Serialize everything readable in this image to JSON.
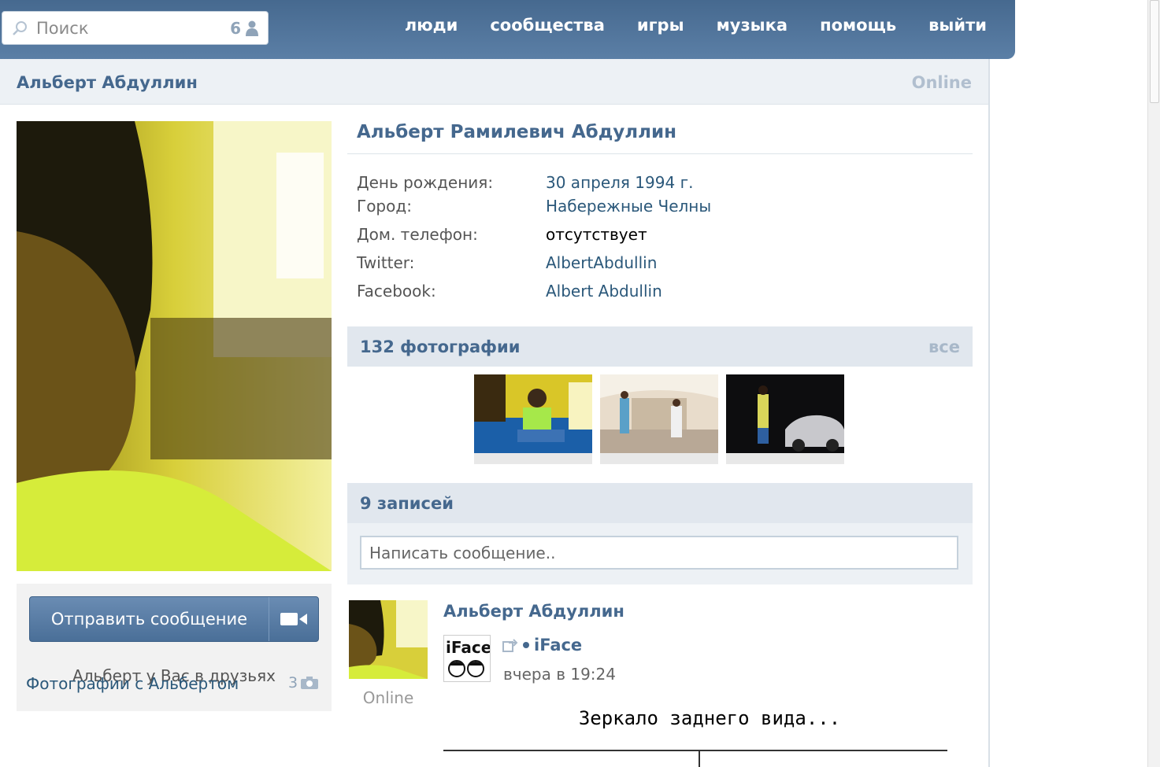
{
  "search": {
    "placeholder": "Поиск",
    "count": "6"
  },
  "nav": {
    "people": "люди",
    "groups": "сообщества",
    "games": "игры",
    "music": "музыка",
    "help": "помощь",
    "logout": "выйти"
  },
  "profile": {
    "header_name": "Альберт Абдуллин",
    "status": "Online",
    "full_name": "Альберт Рамилевич Абдуллин",
    "info": [
      {
        "label": "День рождения:",
        "value": "30 апреля 1994 г."
      },
      {
        "label": "Город:",
        "value": "Набережные Челны"
      },
      {
        "label": "Дом. телефон:",
        "value": "отсутствует"
      },
      {
        "label": "Twitter:",
        "value": "AlbertAbdullin"
      },
      {
        "label": "Facebook:",
        "value": "Albert Abdullin"
      }
    ]
  },
  "actions": {
    "send_message": "Отправить сообщение",
    "friends_note": "Альберт у Вас в друзьях",
    "photos_with": "Фотографии с Альбертом",
    "photos_with_count": "3"
  },
  "photos": {
    "title": "132 фотографии",
    "all": "все"
  },
  "wall": {
    "title": "9 записей",
    "placeholder": "Написать сообщение..",
    "post": {
      "author": "Альберт Абдуллин",
      "online": "Online",
      "repost_logo_text": "iFace",
      "repost_source": "iFace",
      "time": "вчера в 19:24",
      "text": "Зеркало заднего вида..."
    }
  },
  "colors": {
    "header": "#5b7fa6",
    "link": "#2b587a",
    "title": "#45688e",
    "bar": "#e1e7ee"
  }
}
